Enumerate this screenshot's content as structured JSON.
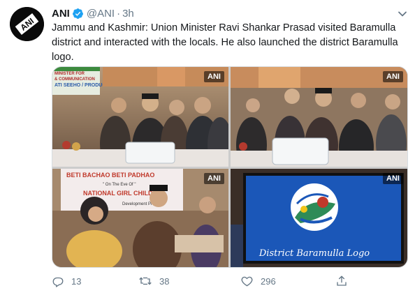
{
  "tweet": {
    "author_name": "ANI",
    "author_handle": "@ANI",
    "separator": "·",
    "timestamp": "3h",
    "text": "Jammu and Kashmir: Union Minister Ravi Shankar Prasad visited Baramulla district and interacted with the locals. He also launched the district Baramulla logo."
  },
  "avatar": {
    "label": "ANI"
  },
  "media": {
    "watermark": "ANI",
    "photo1": {
      "banner_lines": [
        "MINISTER FOR",
        "& COMMUNICATION",
        "ATI SEEHO / PRODUC"
      ]
    },
    "photo3": {
      "banner_line1": "BETI BACHAO BETI PADHAO",
      "banner_line2": "\" On The Eve Of \"",
      "banner_line3": "NATIONAL GIRL CHILD D",
      "banner_line4": "Development Progr"
    },
    "photo4": {
      "logo_caption": "District Baramulla Logo"
    }
  },
  "actions": {
    "reply_count": "13",
    "retweet_count": "38",
    "like_count": "296"
  },
  "colors": {
    "verified": "#1da1f2",
    "secondary_text": "#657786",
    "screen_blue": "#1b57b8"
  },
  "icons": [
    "verified-badge-icon",
    "caret-down-icon",
    "reply-icon",
    "retweet-icon",
    "like-icon",
    "share-icon"
  ]
}
